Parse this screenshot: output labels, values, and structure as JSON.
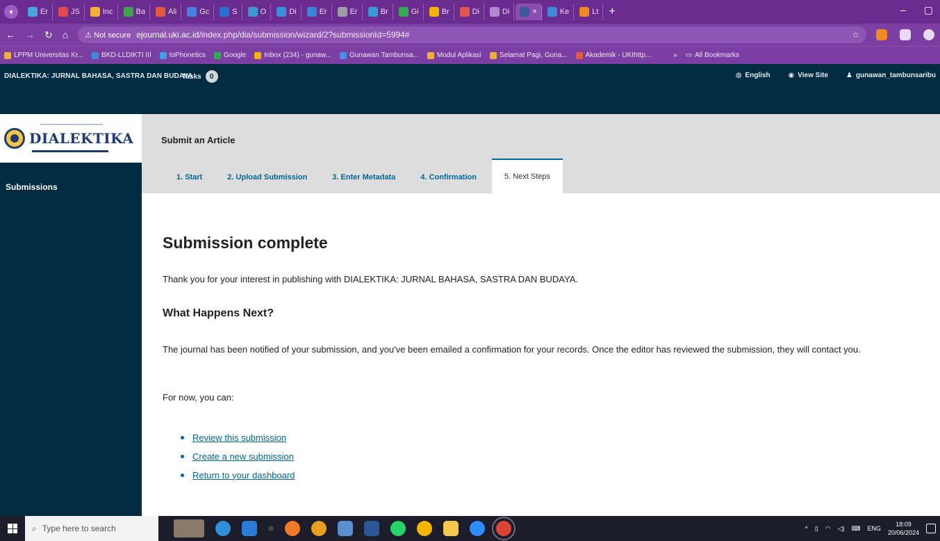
{
  "browser": {
    "tabs": [
      {
        "label": "Er",
        "color": "#4aa3df"
      },
      {
        "label": "JS",
        "color": "#e24b4b"
      },
      {
        "label": "Inc",
        "color": "#f2b134"
      },
      {
        "label": "Ba",
        "color": "#3fa34d"
      },
      {
        "label": "Ali",
        "color": "#e25c3b"
      },
      {
        "label": "Gc",
        "color": "#4a7fe2"
      },
      {
        "label": "S",
        "color": "#2b6fd6"
      },
      {
        "label": "O",
        "color": "#3d9ad1"
      },
      {
        "label": "Di",
        "color": "#3b8fd9"
      },
      {
        "label": "Er",
        "color": "#3c84d6"
      },
      {
        "label": "Er",
        "color": "#9aa0a6"
      },
      {
        "label": "Br",
        "color": "#3a9bd4"
      },
      {
        "label": "Gi",
        "color": "#34a853"
      },
      {
        "label": "Br",
        "color": "#f4b400"
      },
      {
        "label": "Di",
        "color": "#e2574c"
      },
      {
        "label": "Di",
        "color": "#b08ad0"
      },
      {
        "label": "×",
        "color": "#3b5998",
        "active": true
      },
      {
        "label": "Ke",
        "color": "#3d8bd6"
      },
      {
        "label": "Lt",
        "color": "#f08a24"
      }
    ],
    "new_tab": "+",
    "minimize": "–",
    "restore": "▢",
    "address": {
      "warning": "⚠ Not secure",
      "host": "ejournal.uki.ac.id",
      "path": "/index.php/dia/submission/wizard/2?submissionId=5994#"
    },
    "bookmarks": [
      {
        "label": "LPPM Universitas Kr...",
        "color": "#f2b134"
      },
      {
        "label": "BKD-LLDIKTI III",
        "color": "#3d8bd6"
      },
      {
        "label": "toPhonetics",
        "color": "#3ba0e6"
      },
      {
        "label": "Google",
        "color": "#34a853"
      },
      {
        "label": "Inbox (234) - gunaw...",
        "color": "#f4b400"
      },
      {
        "label": "Gunawan Tambunsa...",
        "color": "#4a90e2"
      },
      {
        "label": "Modul Aplikasi",
        "color": "#f2b134"
      },
      {
        "label": "Selamat Pagi, Guna...",
        "color": "#f2b134"
      },
      {
        "label": "Akademik - UKIhttp...",
        "color": "#e25c3b"
      }
    ],
    "more_bookmarks": "»",
    "all_bookmarks": "All Bookmarks"
  },
  "ojs": {
    "context_title": "DIALEKTIKA: JURNAL BAHASA, SASTRA DAN BUDAYA",
    "tasks_label": "Tasks",
    "tasks_count": "0",
    "language": "English",
    "view_site": "View Site",
    "user": "gunawan_tambunsaribu"
  },
  "sidebar": {
    "logo_text": "DIALEKTIKA",
    "items": [
      {
        "label": "Submissions"
      }
    ]
  },
  "main": {
    "page_title": "Submit an Article",
    "steps": [
      {
        "label": "1. Start"
      },
      {
        "label": "2. Upload Submission"
      },
      {
        "label": "3. Enter Metadata"
      },
      {
        "label": "4. Confirmation"
      },
      {
        "label": "5. Next Steps",
        "current": true
      }
    ],
    "heading": "Submission complete",
    "thanks": "Thank you for your interest in publishing with DIALEKTIKA: JURNAL BAHASA, SASTRA DAN BUDAYA.",
    "next_heading": "What Happens Next?",
    "next_text": "The journal has been notified of your submission, and you've been emailed a confirmation for your records. Once the editor has reviewed the submission, they will contact you.",
    "for_now": "For now, you can:",
    "links": [
      {
        "label": "Review this submission"
      },
      {
        "label": "Create a new submission"
      },
      {
        "label": "Return to your dashboard"
      }
    ]
  },
  "taskbar": {
    "search_placeholder": "Type here to search",
    "language": "ENG",
    "time": "18:09",
    "date": "20/06/2024"
  },
  "colors": {
    "ojs_dark": "#002b40",
    "link": "#006798",
    "browser_purple": "#6a2d8f"
  }
}
